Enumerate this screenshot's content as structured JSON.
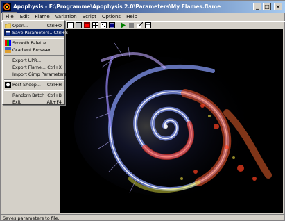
{
  "window": {
    "title": "Apophysis - F:\\Programme\\Apophysis 2.0\\Parameters\\My Flames.flame",
    "buttons": {
      "minimize": "_",
      "maximize": "□",
      "close": "×"
    }
  },
  "menubar": [
    "File",
    "Edit",
    "Flame",
    "Variation",
    "Script",
    "Options",
    "Help"
  ],
  "file_menu": [
    {
      "label": "Open...",
      "shortcut": "Ctrl+O",
      "icon": "open-folder-icon"
    },
    {
      "label": "Save Parameters...",
      "shortcut": "Ctrl+S",
      "icon": "save-icon",
      "highlighted": true
    },
    {
      "label": "Smooth Palette...",
      "shortcut": "",
      "icon": "palette-icon"
    },
    {
      "label": "Gradient Browser...",
      "shortcut": "",
      "icon": "gradient-icon"
    },
    {
      "label": "Export UPR...",
      "shortcut": "",
      "icon": ""
    },
    {
      "label": "Export Flame...",
      "shortcut": "Ctrl+X",
      "icon": ""
    },
    {
      "label": "Import Gimp Parameters",
      "shortcut": "",
      "icon": ""
    },
    {
      "label": "Post Sheep...",
      "shortcut": "Ctrl+H",
      "icon": "sheep-icon"
    },
    {
      "label": "Random Batch",
      "shortcut": "Ctrl+B",
      "icon": ""
    },
    {
      "label": "Exit",
      "shortcut": "Alt+F4",
      "icon": ""
    }
  ],
  "status": {
    "text": "Saves parameters to file."
  },
  "colors": {
    "titlebar_start": "#0a246a",
    "titlebar_end": "#a6caf0",
    "highlight": "#0a246a",
    "canvas": "#000000"
  }
}
